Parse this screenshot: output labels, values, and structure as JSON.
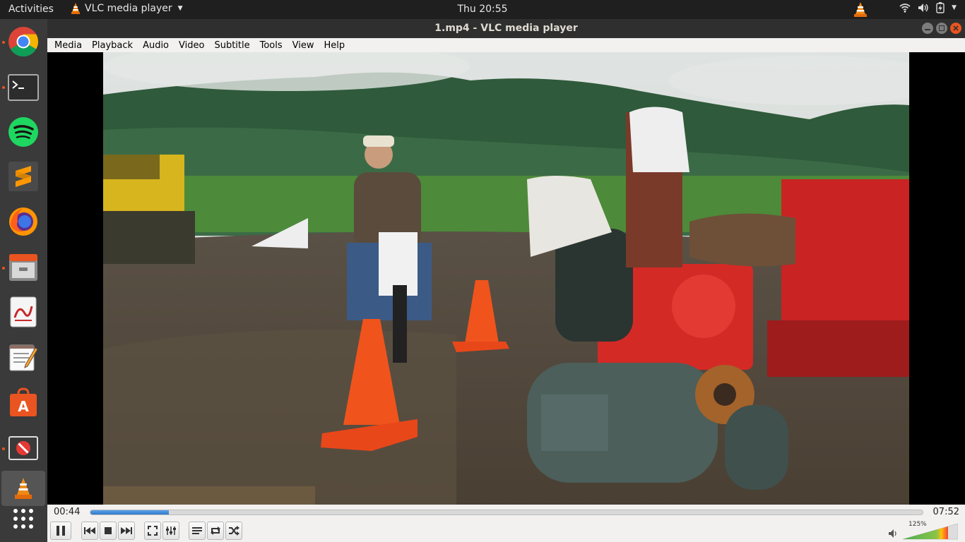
{
  "topbar": {
    "activities": "Activities",
    "app_name": "VLC media player",
    "clock": "Thu 20:55"
  },
  "dock": {
    "items": [
      "chrome",
      "terminal",
      "spotify",
      "sublime-text",
      "firefox",
      "files",
      "document-viewer",
      "text-editor",
      "software-center",
      "blocked-app",
      "vlc"
    ]
  },
  "window": {
    "title": "1.mp4 - VLC media player",
    "menu": [
      "Media",
      "Playback",
      "Audio",
      "Video",
      "Subtitle",
      "Tools",
      "View",
      "Help"
    ]
  },
  "player": {
    "elapsed": "00:44",
    "total": "07:52",
    "progress_fraction": 0.094,
    "volume": "125%",
    "accent_color": "#2f78c7"
  }
}
